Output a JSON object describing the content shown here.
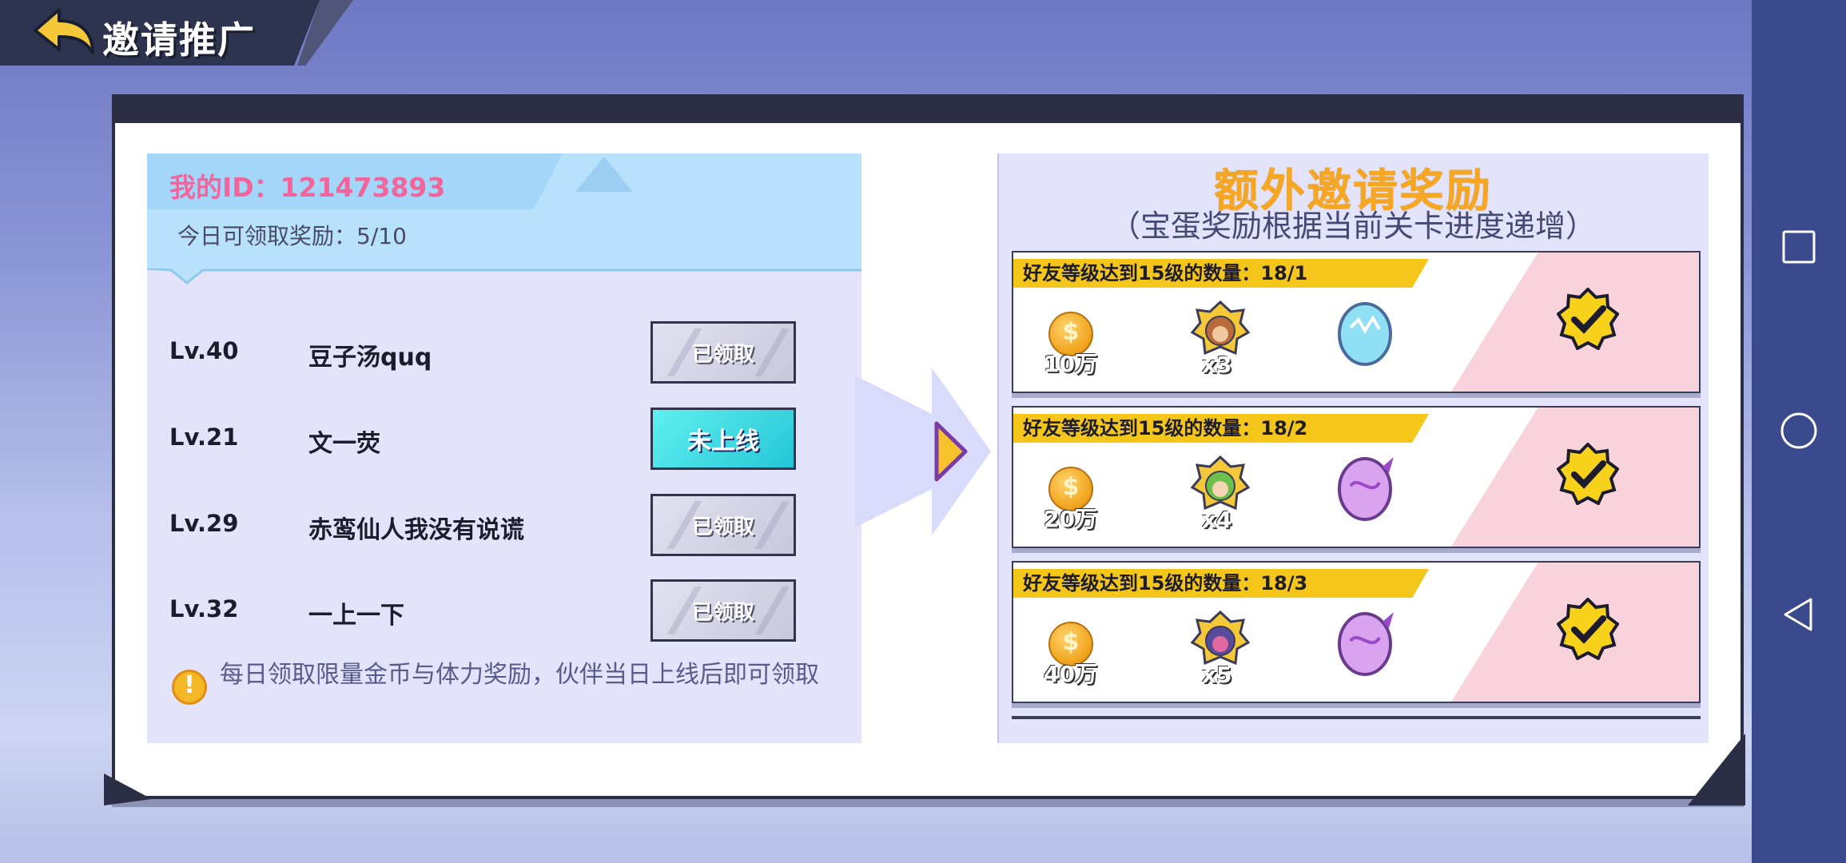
{
  "header": {
    "title": "邀请推广"
  },
  "my_info": {
    "id_label": "我的ID：121473893",
    "daily_label": "今日可领取奖励：5/10"
  },
  "friends": [
    {
      "level": "Lv.40",
      "name": "豆子汤quq",
      "button": "已领取",
      "state": "claimed"
    },
    {
      "level": "Lv.21",
      "name": "文一荧",
      "button": "未上线",
      "state": "offline"
    },
    {
      "level": "Lv.29",
      "name": "赤鸾仙人我没有说谎",
      "button": "已领取",
      "state": "claimed"
    },
    {
      "level": "Lv.32",
      "name": "一上一下",
      "button": "已领取",
      "state": "claimed"
    }
  ],
  "notice": "每日领取限量金币与体力奖励，伙伴当日上线后即可领取",
  "rewards": {
    "title": "额外邀请奖励",
    "subtitle": "（宝蛋奖励根据当前关卡进度递增）",
    "tiers": [
      {
        "condition": "好友等级达到15级的数量：18/1",
        "coins": "10万",
        "hero_count": "x3",
        "egg": "blue-egg",
        "claimed": true
      },
      {
        "condition": "好友等级达到15级的数量：18/2",
        "coins": "20万",
        "hero_count": "x4",
        "egg": "purple-egg",
        "claimed": true
      },
      {
        "condition": "好友等级达到15级的数量：18/3",
        "coins": "40万",
        "hero_count": "x5",
        "egg": "purple-egg",
        "claimed": true
      }
    ]
  },
  "colors": {
    "accent_pink": "#f0669c",
    "reward_orange": "#f5a623",
    "banner_yellow": "#f5c61a",
    "offline_cyan": "#26c6d6"
  },
  "icons": [
    "back-arrow-icon",
    "warning-icon",
    "coin-icon",
    "hero-icon",
    "egg-icon",
    "check-badge-icon",
    "square-nav-icon",
    "circle-nav-icon",
    "triangle-nav-icon"
  ]
}
